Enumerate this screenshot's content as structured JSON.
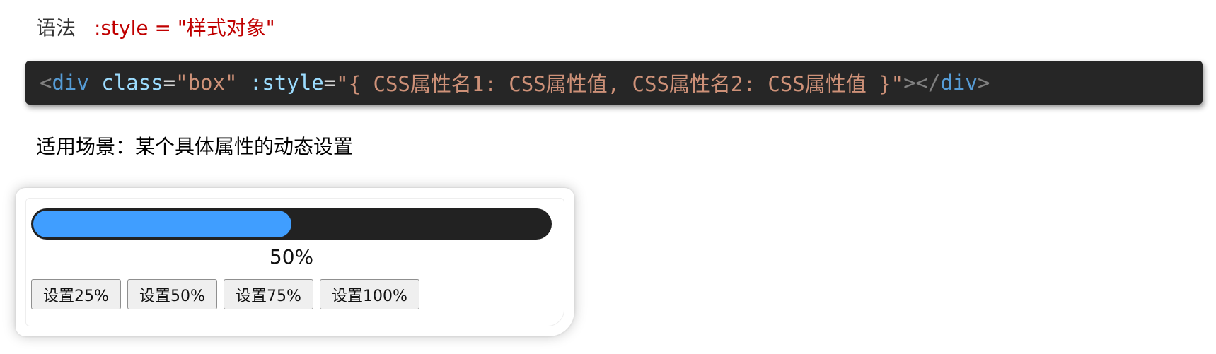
{
  "syntax": {
    "label": "语法",
    "code": ":style = \"样式对象\""
  },
  "code_block": {
    "open_bracket": "<",
    "tag_open": "div",
    "space1": " ",
    "class_attr": "class",
    "eq1": "=",
    "class_value": "\"box\"",
    "space2": " ",
    "style_attr": ":style",
    "eq2": "=",
    "style_value": "\"{ CSS属性名1: CSS属性值, CSS属性名2: CSS属性值 }\"",
    "close_open_bracket": "></",
    "tag_close": "div",
    "close_bracket": ">"
  },
  "scenario": {
    "text": "适用场景：某个具体属性的动态设置"
  },
  "demo": {
    "progress_percent": 50,
    "progress_label": "50%",
    "buttons": [
      {
        "label": "设置25%"
      },
      {
        "label": "设置50%"
      },
      {
        "label": "设置75%"
      },
      {
        "label": "设置100%"
      }
    ]
  },
  "colors": {
    "code_bg": "#262626",
    "progress_track": "#222222",
    "progress_fill": "#409eff",
    "syntax_code": "#c00000"
  }
}
